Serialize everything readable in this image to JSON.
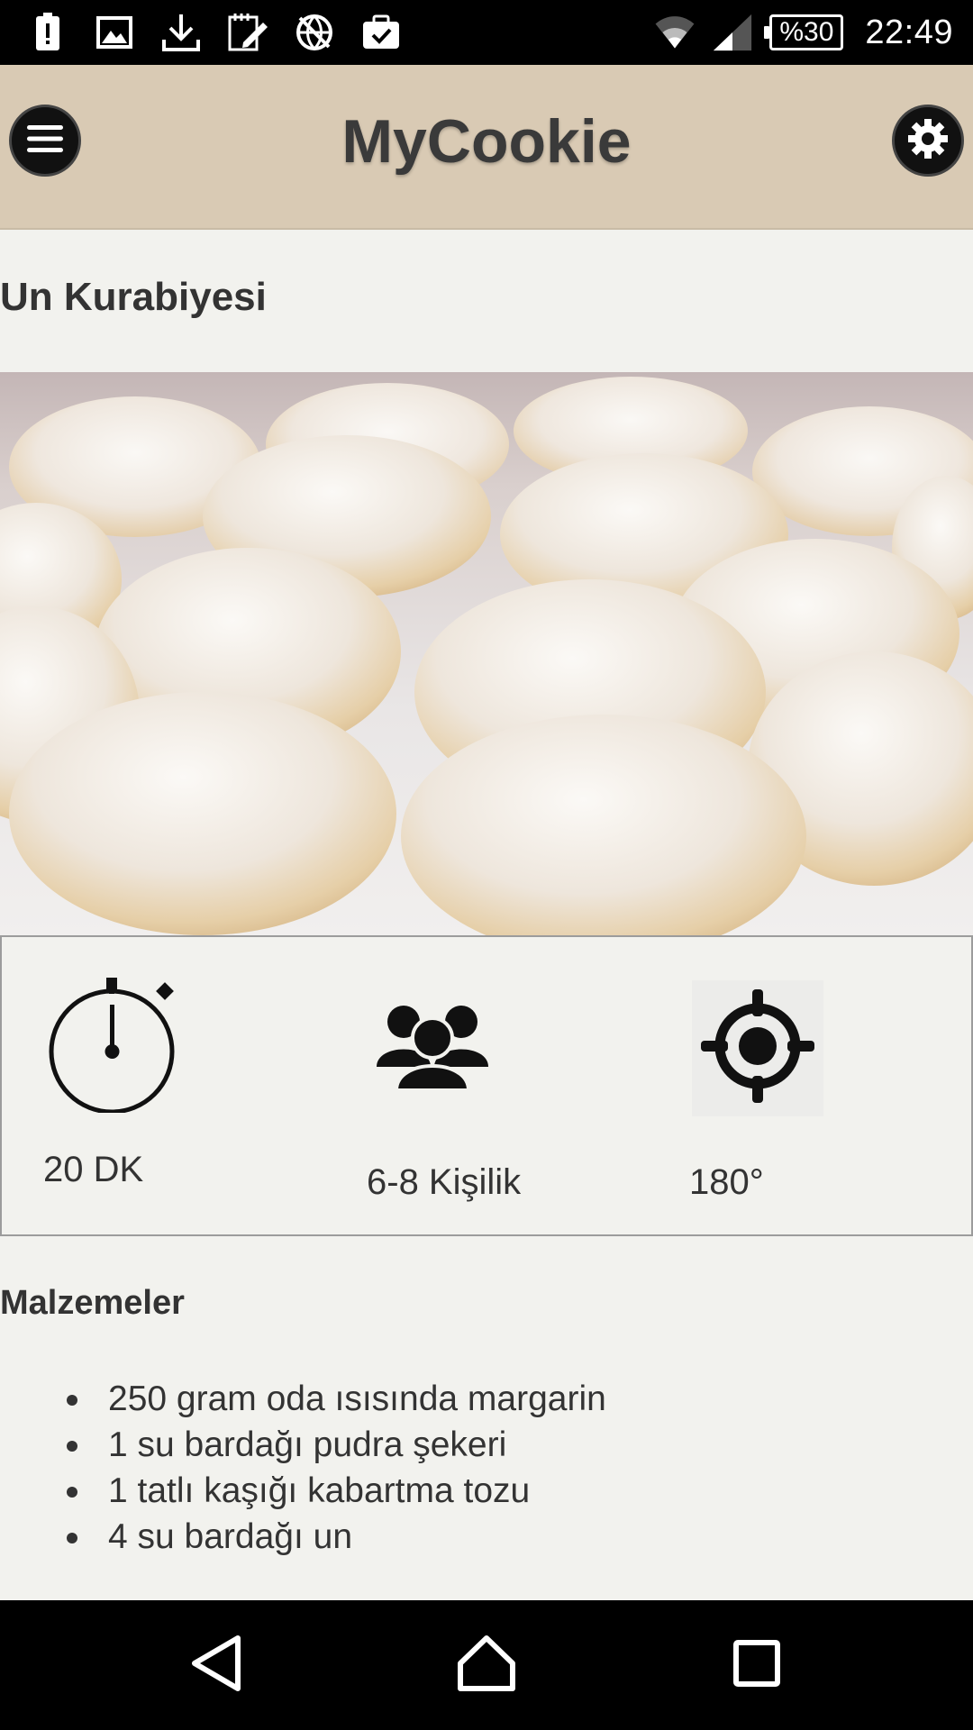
{
  "status_bar": {
    "battery": "%30",
    "time": "22:49",
    "icons": [
      "alert-icon",
      "image-icon",
      "download-icon",
      "note-edit-icon",
      "vpn-icon",
      "task-icon",
      "wifi-icon",
      "signal-icon",
      "battery-icon"
    ]
  },
  "app_bar": {
    "title": "MyCookie",
    "menu_icon": "hamburger-icon",
    "settings_icon": "gear-icon"
  },
  "recipe": {
    "title": "Un Kurabiyesi",
    "time": "20 DK",
    "servings": "6-8 Kişilik",
    "temperature": "180°"
  },
  "ingredients": {
    "title": "Malzemeler",
    "items": [
      "250 gram oda ısısında margarin",
      "1 su bardağı pudra şekeri",
      "1 tatlı kaşığı kabartma tozu",
      "4 su bardağı un"
    ]
  },
  "nav": {
    "back_icon": "back-icon",
    "home_icon": "home-icon",
    "recents_icon": "recents-icon"
  },
  "colors": {
    "app_bar": "#d9cab4",
    "background": "#f2f2ee",
    "text": "#333333"
  }
}
